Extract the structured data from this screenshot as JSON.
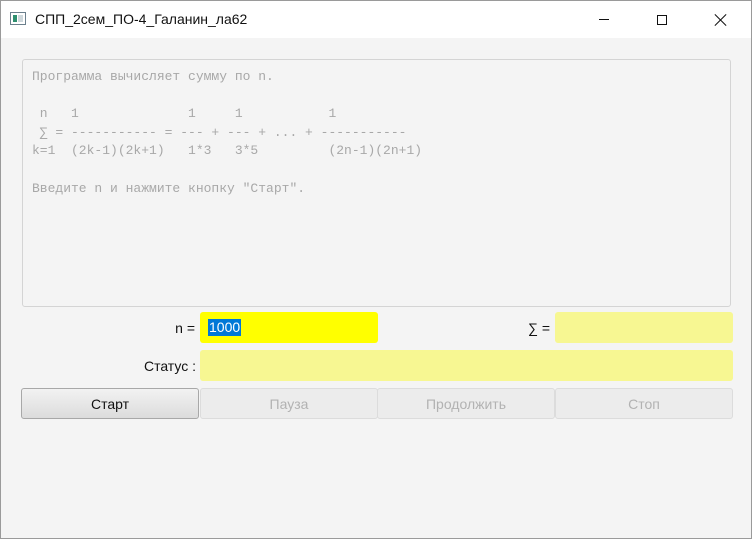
{
  "window": {
    "title": "СПП_2сем_ПО-4_Галанин_ла62",
    "icon": "java-app-icon"
  },
  "output": {
    "text": "Программа вычисляет сумму по n.\n\n n   1              1     1           1\n ∑ = ----------- = --- + --- + ... + -----------\nk=1  (2k-1)(2k+1)   1*3   3*5         (2n-1)(2n+1)\n\nВведите n и нажмите кнопку \"Старт\"."
  },
  "form": {
    "n_label": "n =",
    "n_value": "1000",
    "sum_label": "∑ =",
    "sum_value": "",
    "status_label": "Статус :",
    "status_value": ""
  },
  "buttons": {
    "start": "Старт",
    "pause": "Пауза",
    "continue": "Продолжить",
    "stop": "Стоп"
  },
  "colors": {
    "n_field": "#ffff00",
    "readonly_field": "#f7f792",
    "selection": "#0078d7"
  }
}
